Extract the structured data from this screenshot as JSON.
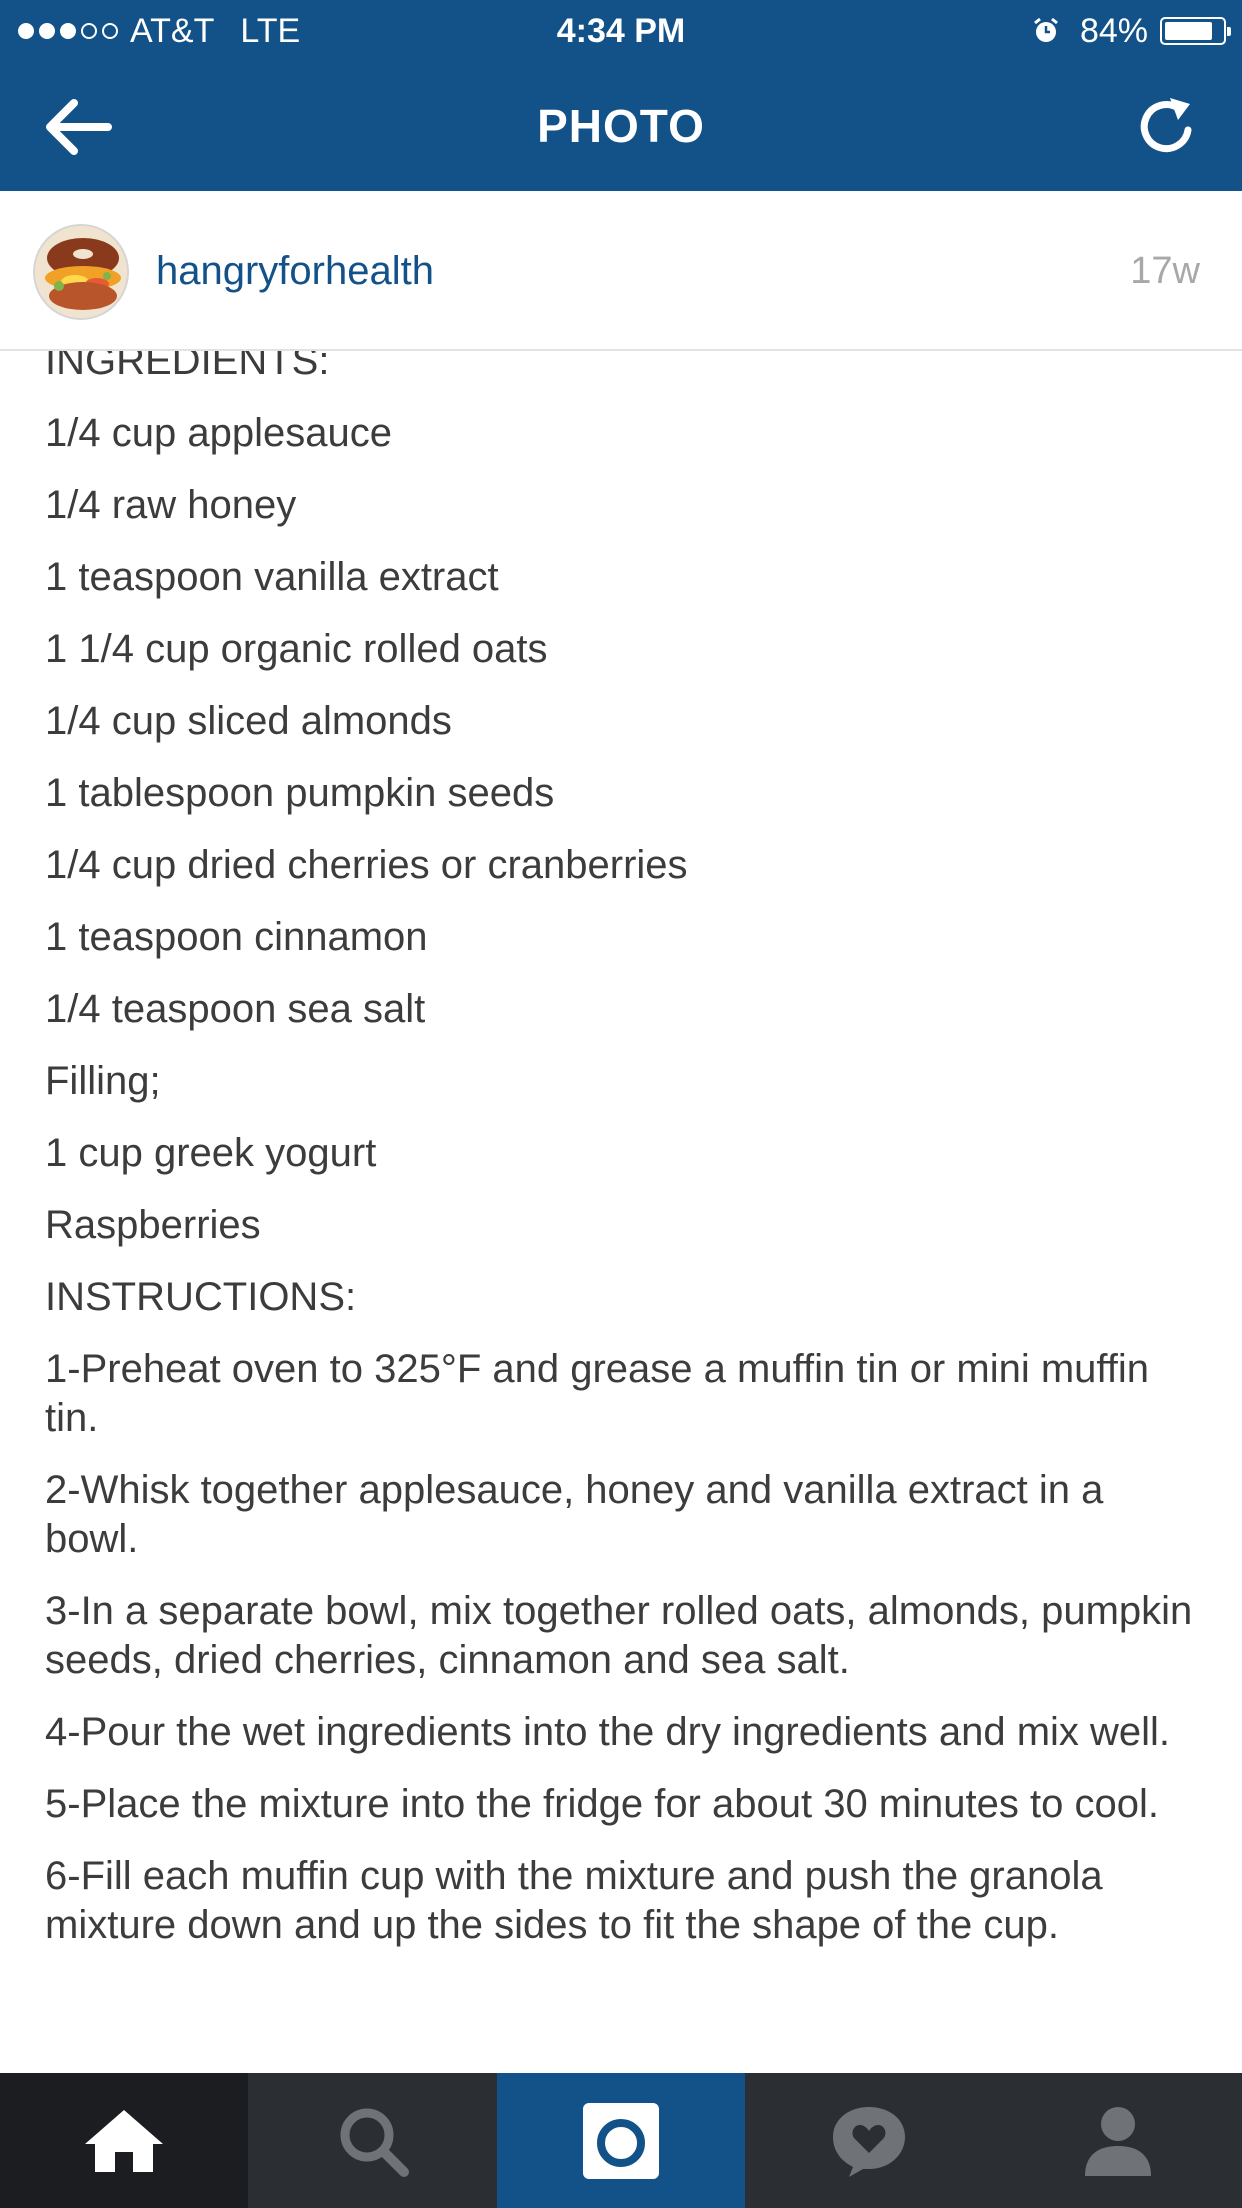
{
  "status_bar": {
    "carrier": "AT&T",
    "network": "LTE",
    "time": "4:34 PM",
    "battery_percent": "84%",
    "battery_level": 0.84,
    "signal_bars_filled": 3,
    "signal_bars_total": 5
  },
  "nav": {
    "title": "PHOTO",
    "back_icon": "arrow-left-icon",
    "refresh_icon": "refresh-icon"
  },
  "post": {
    "username": "hangryforhealth",
    "age": "17w",
    "caption_lines": [
      "INGREDIENTS:",
      "1/4 cup applesauce",
      "1/4 raw honey",
      "1 teaspoon vanilla extract",
      "1 1/4 cup organic rolled oats",
      "1/4 cup sliced almonds",
      "1 tablespoon pumpkin seeds",
      "1/4 cup dried cherries or cranberries",
      "1 teaspoon cinnamon",
      "1/4 teaspoon sea salt",
      "Filling;",
      "1 cup greek yogurt",
      "Raspberries",
      "INSTRUCTIONS:",
      "1-Preheat oven to 325°F and grease a muffin tin or mini muffin tin.",
      "2-Whisk together applesauce, honey and vanilla extract in a bowl.",
      "3-In a separate bowl, mix together rolled oats, almonds, pumpkin seeds, dried cherries, cinnamon and sea salt.",
      "4-Pour the wet ingredients into the dry ingredients and mix well.",
      "5-Place the mixture into the fridge for about 30 minutes to cool.",
      "6-Fill each muffin cup with the mixture and push the granola mixture down and up the sides to fit the shape of the cup."
    ]
  },
  "tabbar": {
    "tabs": [
      {
        "icon": "home-icon",
        "active": true
      },
      {
        "icon": "search-icon",
        "active": false
      },
      {
        "icon": "camera-icon",
        "active": false
      },
      {
        "icon": "activity-heart-icon",
        "active": false
      },
      {
        "icon": "profile-icon",
        "active": false
      }
    ]
  },
  "colors": {
    "brand_blue": "#135288",
    "tabbar_bg": "#2b2e33",
    "tab_active_bg": "#1b1d20",
    "text": "#3c3c3c",
    "timestamp": "#a8a8a8"
  }
}
